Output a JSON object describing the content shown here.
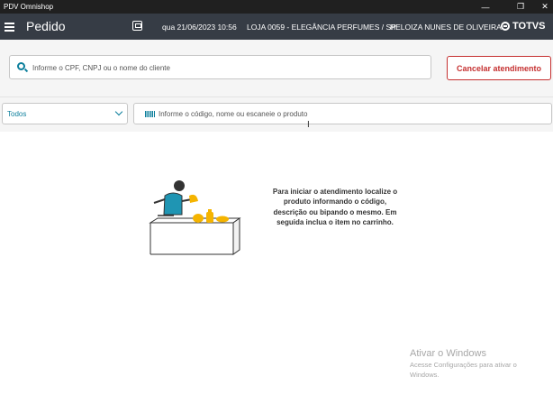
{
  "window": {
    "title": "PDV Omnishop"
  },
  "header": {
    "title": "Pedido",
    "datetime": "qua 21/06/2023 10:56",
    "store": "LOJA 0059 - ELEGÂNCIA PERFUMES / SP",
    "user": "HELOIZA NUNES DE OLIVEIRA",
    "brand": "TOTVS"
  },
  "customer_search": {
    "placeholder": "Informe o CPF, CNPJ ou o nome do cliente"
  },
  "cancel_button": {
    "label": "Cancelar atendimento"
  },
  "filter": {
    "selected": "Todos"
  },
  "product_search": {
    "placeholder": "Informe o código, nome ou escaneie o produto"
  },
  "empty_state": {
    "message": "Para iniciar o atendimento localize o produto informando o código, descrição ou bipando o mesmo. Em seguida inclua o item no carrinho."
  },
  "watermark": {
    "title": "Ativar o Windows",
    "text": "Acesse Configurações para ativar o Windows."
  },
  "colors": {
    "accent": "#0c7f9c",
    "danger": "#c53030",
    "appbar": "#363c45",
    "titlebar": "#202020"
  },
  "icons": [
    "menu-icon",
    "pos-icon",
    "totvs-logo-icon",
    "search-icon",
    "chevron-down-icon",
    "barcode-icon",
    "minimize-icon",
    "restore-icon",
    "close-icon"
  ]
}
